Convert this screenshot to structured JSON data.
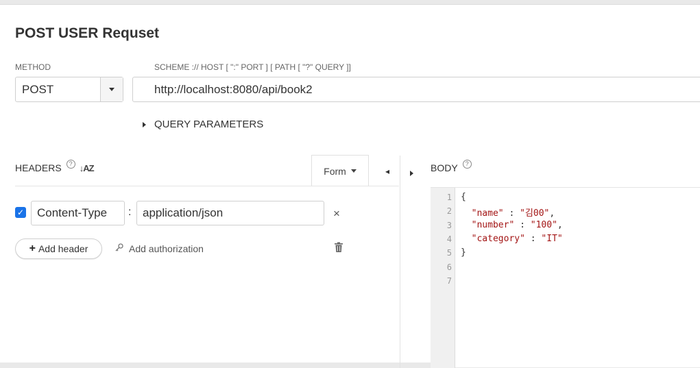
{
  "request": {
    "title": "POST USER Requset",
    "method_label": "METHOD",
    "method_value": "POST",
    "url_hint": "SCHEME :// HOST [ \":\" PORT ] [ PATH [ \"?\" QUERY ]]",
    "url_value": "http://localhost:8080/api/book2",
    "query_params_label": "QUERY PARAMETERS"
  },
  "headers": {
    "label": "HEADERS",
    "help_glyph": "?",
    "sort_glyph": "↓AZ",
    "form_label": "Form",
    "rows": [
      {
        "key": "Content-Type",
        "value": "application/json",
        "checked": true
      }
    ],
    "colon": ":",
    "remove_glyph": "×",
    "add_header_label": "Add header",
    "add_authorization_label": "Add authorization"
  },
  "body": {
    "label": "BODY",
    "help_glyph": "?",
    "line_numbers": [
      "1",
      "2",
      "3",
      "4",
      "5",
      "6",
      "7"
    ],
    "lines": [
      {
        "prefix": "{",
        "key": "",
        "sep": "",
        "val": "",
        "suffix": ""
      },
      {
        "prefix": "  ",
        "key": "\"name\"",
        "sep": " : ",
        "val": "\"김00\"",
        "suffix": ","
      },
      {
        "prefix": "  ",
        "key": "\"number\"",
        "sep": " : ",
        "val": "\"100\"",
        "suffix": ","
      },
      {
        "prefix": "  ",
        "key": "\"category\"",
        "sep": " : ",
        "val": "\"IT\"",
        "suffix": ""
      },
      {
        "prefix": "}",
        "key": "",
        "sep": "",
        "val": "",
        "suffix": ""
      },
      {
        "prefix": "",
        "key": "",
        "sep": "",
        "val": "",
        "suffix": ""
      },
      {
        "prefix": "",
        "key": "",
        "sep": "",
        "val": "",
        "suffix": ""
      }
    ]
  },
  "colors": {
    "accent": "#1a73e8",
    "json_string": "#a31515"
  }
}
